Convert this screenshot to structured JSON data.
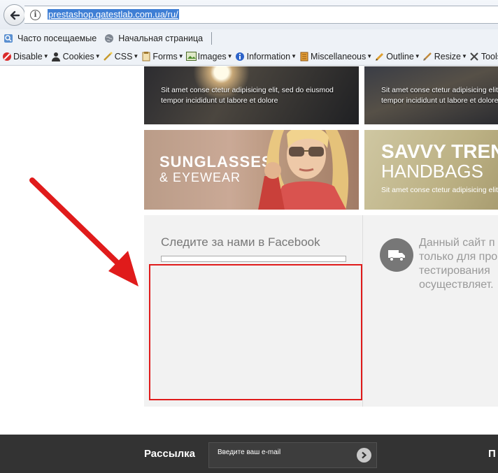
{
  "browser": {
    "url": "prestashop.qatestlab.com.ua/ru/",
    "bookmarks": [
      {
        "label": "Часто посещаемые",
        "icon": "bookmark-folder-icon"
      },
      {
        "label": "Начальная страница",
        "icon": "globe-icon"
      }
    ],
    "webdev_menu": [
      {
        "label": "Disable",
        "icon": "disable-icon"
      },
      {
        "label": "Cookies",
        "icon": "cookies-icon"
      },
      {
        "label": "CSS",
        "icon": "css-icon"
      },
      {
        "label": "Forms",
        "icon": "forms-icon"
      },
      {
        "label": "Images",
        "icon": "images-icon"
      },
      {
        "label": "Information",
        "icon": "information-icon"
      },
      {
        "label": "Miscellaneous",
        "icon": "miscellaneous-icon"
      },
      {
        "label": "Outline",
        "icon": "outline-icon"
      },
      {
        "label": "Resize",
        "icon": "resize-icon"
      },
      {
        "label": "Tools",
        "icon": "tools-icon"
      }
    ]
  },
  "banners": {
    "top_left": {
      "text_line1": "Sit amet conse ctetur adipisicing elit, sed do eiusmod",
      "text_line2": "tempor incididunt ut labore et dolore"
    },
    "top_right": {
      "text_line1": "Sit amet conse ctetur adipisicing elit,",
      "text_line2": "tempor incididunt ut labore et dolore"
    },
    "sunglasses": {
      "title": "SUNGLASSES",
      "subtitle": "& EYEWEAR"
    },
    "savvy": {
      "title": "SAVVY TREN",
      "subtitle": "HANDBAGS",
      "text": "Sit amet conse ctetur adipisicing elit,"
    }
  },
  "facebook": {
    "title": "Следите за нами в Facebook"
  },
  "info_block": {
    "icon": "truck-icon",
    "lines": [
      "Данный сайт п",
      "только для про",
      "тестирования",
      "осуществляет."
    ]
  },
  "footer": {
    "newsletter_label": "Рассылка",
    "email_placeholder": "Введите ваш e-mail",
    "right_heading": "П"
  },
  "colors": {
    "annotation_red": "#e01b1b",
    "footer_bg": "#333333",
    "band_bg": "#f2f2f2"
  }
}
